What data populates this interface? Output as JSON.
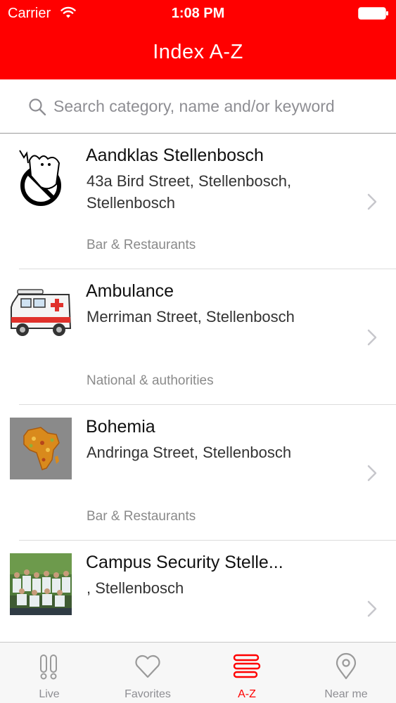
{
  "status_bar": {
    "carrier": "Carrier",
    "time": "1:08 PM"
  },
  "nav": {
    "title": "Index A-Z"
  },
  "search": {
    "placeholder": "Search category, name and/or keyword",
    "value": ""
  },
  "items": [
    {
      "name": "Aandklas Stellenbosch",
      "address": "43a Bird Street, Stellenbosch, Stellenbosch",
      "category": "Bar & Restaurants",
      "thumbnail": "ghost-logo-icon"
    },
    {
      "name": "Ambulance",
      "address": "Merriman Street, Stellenbosch",
      "category": "National & authorities",
      "thumbnail": "ambulance-icon"
    },
    {
      "name": "Bohemia",
      "address": "Andringa Street, Stellenbosch",
      "category": "Bar & Restaurants",
      "thumbnail": "africa-map-image"
    },
    {
      "name": "Campus Security Stelle...",
      "address": ", Stellenbosch",
      "category": "",
      "thumbnail": "group-photo-image"
    }
  ],
  "tabs": [
    {
      "label": "Live",
      "icon": "live-icon",
      "active": false
    },
    {
      "label": "Favorites",
      "icon": "heart-icon",
      "active": false
    },
    {
      "label": "A-Z",
      "icon": "a-z-list-icon",
      "active": true
    },
    {
      "label": "Near me",
      "icon": "location-pin-icon",
      "active": false
    }
  ],
  "colors": {
    "brand_red": "#ff0000",
    "inactive_tab": "#8e8e93",
    "category_text": "#8a8a8a"
  }
}
